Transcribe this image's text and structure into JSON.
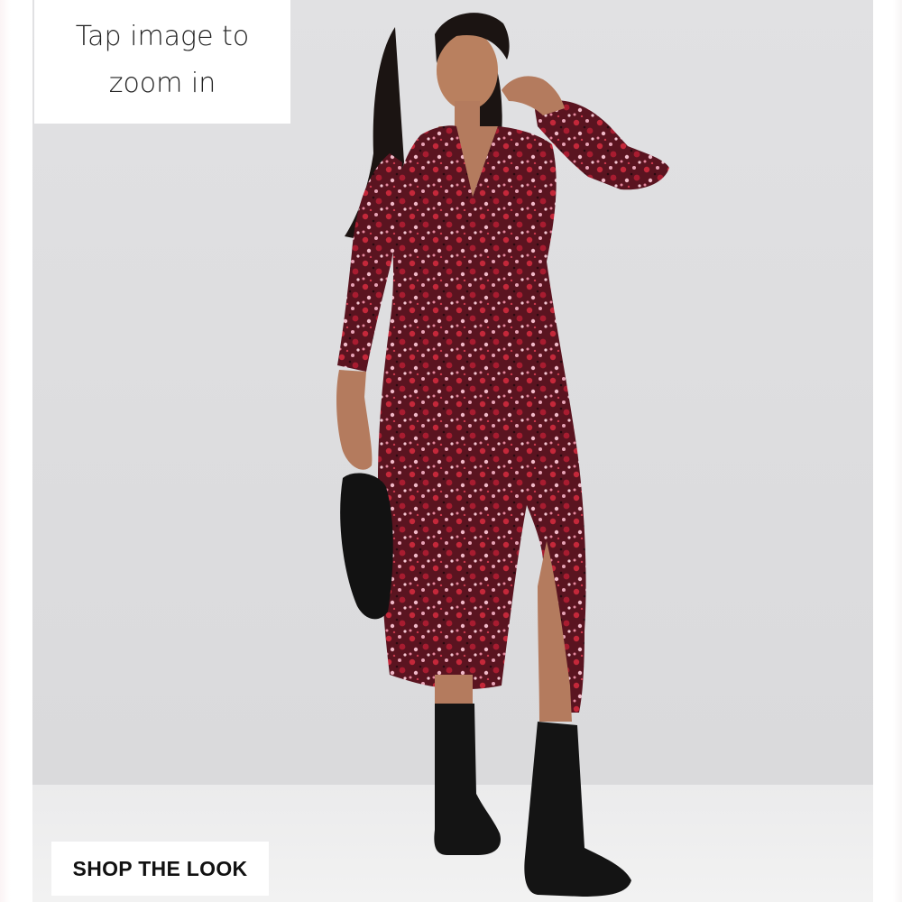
{
  "product_gallery": {
    "zoom_hint": "Tap image to zoom in",
    "shop_the_look_label": "SHOP THE LOOK"
  },
  "image": {
    "subject": "model wearing red ditsy floral print long sleeve midi dress with side split and black chunky boots",
    "icon": "product-photo"
  }
}
